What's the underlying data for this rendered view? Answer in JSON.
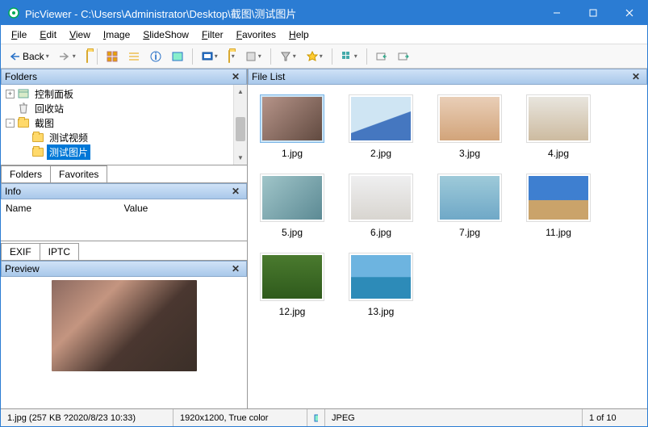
{
  "window": {
    "app_name": "PicViewer",
    "title": "PicViewer - C:\\Users\\Administrator\\Desktop\\截图\\测试图片"
  },
  "menus": [
    "File",
    "Edit",
    "View",
    "Image",
    "SlideShow",
    "Filter",
    "Favorites",
    "Help"
  ],
  "toolbar": {
    "back_label": "Back"
  },
  "panels": {
    "folders_title": "Folders",
    "info_title": "Info",
    "preview_title": "Preview",
    "filelist_title": "File List"
  },
  "folder_tree": [
    {
      "depth": 0,
      "expand": "+",
      "icon": "panel",
      "label": "控制面板"
    },
    {
      "depth": 0,
      "expand": "",
      "icon": "bin",
      "label": "回收站"
    },
    {
      "depth": 0,
      "expand": "-",
      "icon": "folder",
      "label": "截图"
    },
    {
      "depth": 1,
      "expand": "",
      "icon": "folder",
      "label": "测试视频"
    },
    {
      "depth": 1,
      "expand": "",
      "icon": "folder",
      "label": "测试图片",
      "selected": true
    }
  ],
  "left_tabs": {
    "folders": "Folders",
    "favorites": "Favorites"
  },
  "info_cols": {
    "name": "Name",
    "value": "Value"
  },
  "meta_tabs": {
    "exif": "EXIF",
    "iptc": "IPTC"
  },
  "files": [
    {
      "name": "1.jpg",
      "selected": true,
      "bg": "linear-gradient(135deg,#b69489,#614a40)"
    },
    {
      "name": "2.jpg",
      "bg": "linear-gradient(160deg,#cfe5f3 55%,#4577c0 56%)"
    },
    {
      "name": "3.jpg",
      "bg": "linear-gradient(180deg,#e9ceb7,#d2a47a)"
    },
    {
      "name": "4.jpg",
      "bg": "linear-gradient(180deg,#e8e5de,#cdbba0)"
    },
    {
      "name": "5.jpg",
      "bg": "linear-gradient(135deg,#a0c5c9,#5c8a94)"
    },
    {
      "name": "6.jpg",
      "bg": "linear-gradient(180deg,#efeff0,#d8d5d0)"
    },
    {
      "name": "7.jpg",
      "bg": "linear-gradient(180deg,#9ecad9,#6fa8c7)"
    },
    {
      "name": "11.jpg",
      "bg": "linear-gradient(180deg,#3e7fd0 55%,#caa36a 56%)"
    },
    {
      "name": "12.jpg",
      "bg": "linear-gradient(180deg,#4a7a2e,#2f5a1c)"
    },
    {
      "name": "13.jpg",
      "bg": "linear-gradient(180deg,#6db4e0 50%,#2d8bb8 51%)"
    }
  ],
  "status": {
    "file_info": "1.jpg  (257 KB ?2020/8/23 10:33)",
    "dims": "1920x1200, True color",
    "format": "JPEG",
    "counter": "1 of 10"
  }
}
